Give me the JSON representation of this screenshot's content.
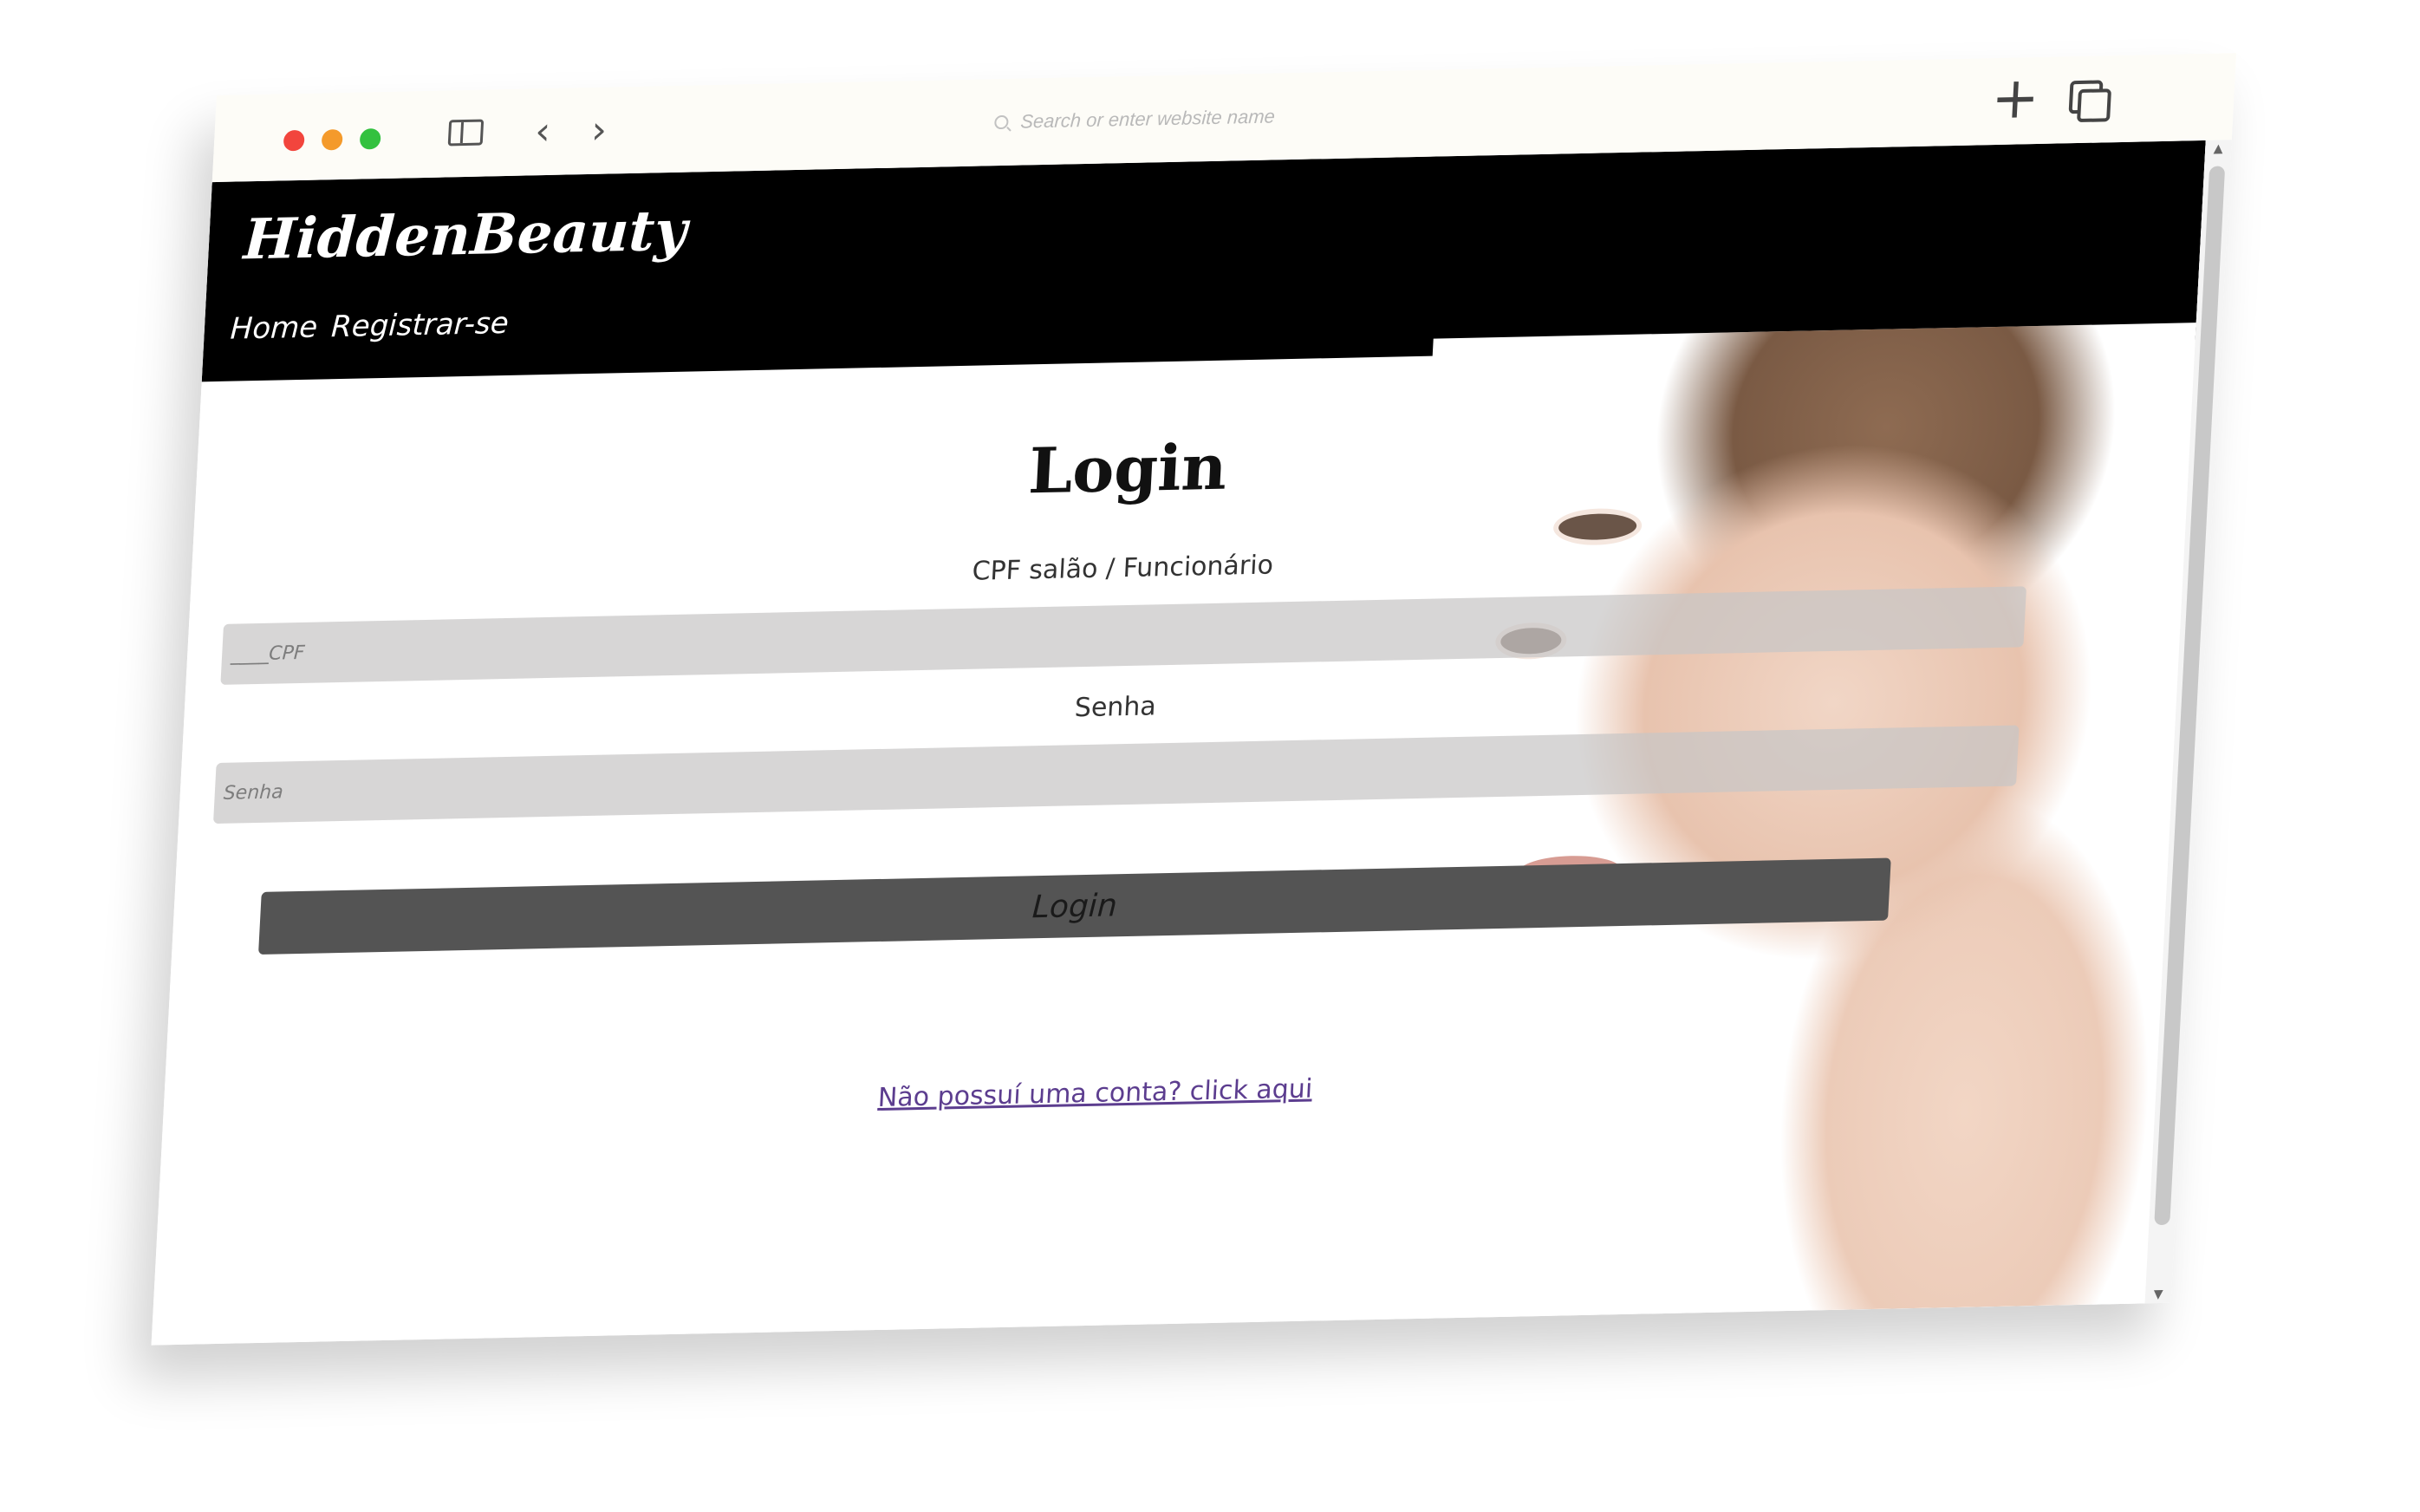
{
  "browser": {
    "address_placeholder": "Search or enter website name",
    "icons": {
      "close": "red-dot",
      "minimize": "yellow-dot",
      "zoom": "green-dot",
      "sidebar": "sidebar-icon",
      "back": "chevron-left-icon",
      "forward": "chevron-right-icon",
      "search": "search-icon",
      "new_tab": "plus-icon",
      "tabs": "tabs-overview-icon"
    },
    "glyphs": {
      "back": "‹",
      "forward": "›",
      "new_tab": "+"
    }
  },
  "header": {
    "brand": "HiddenBeauty",
    "nav": [
      {
        "label": "Home"
      },
      {
        "label": "Registrar-se"
      }
    ]
  },
  "form": {
    "title": "Login",
    "cpf_label": "CPF salão / Funcionário",
    "cpf_placeholder": "____CPF",
    "password_label": "Senha",
    "password_placeholder": "Senha",
    "submit_label": "Login",
    "register_link": "Não possuí uma conta? click aqui"
  },
  "colors": {
    "header_bg": "#000000",
    "field_bg": "#c8c6c6",
    "button_bg": "#545454",
    "link": "#5c3d8f"
  }
}
